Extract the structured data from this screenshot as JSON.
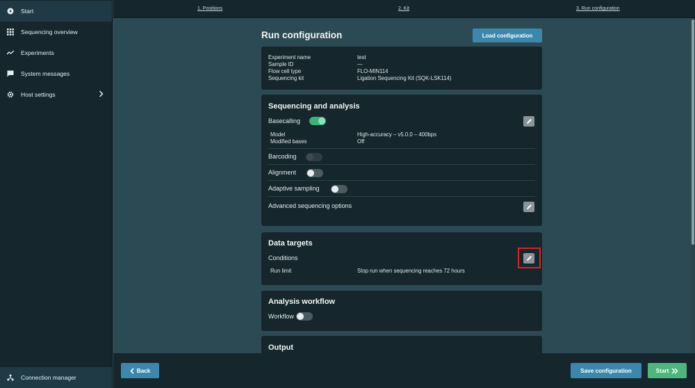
{
  "sidebar": {
    "items": [
      {
        "label": "Start",
        "icon": "play-circle-icon"
      },
      {
        "label": "Sequencing overview",
        "icon": "grid-icon"
      },
      {
        "label": "Experiments",
        "icon": "trend-line-icon"
      },
      {
        "label": "System messages",
        "icon": "chat-bubble-icon"
      },
      {
        "label": "Host settings",
        "icon": "gear-icon"
      }
    ],
    "bottom_label": "Connection manager",
    "bottom_icon": "network-icon"
  },
  "steps": [
    "1. Positions",
    "2. Kit",
    "3. Run configuration"
  ],
  "page": {
    "title": "Run configuration",
    "load_button": "Load configuration"
  },
  "summary": [
    {
      "key": "Experiment name",
      "value": "test"
    },
    {
      "key": "Sample ID",
      "value": "—"
    },
    {
      "key": "Flow cell type",
      "value": "FLO-MIN114"
    },
    {
      "key": "Sequencing kit",
      "value": "Ligation Sequencing Kit (SQK-LSK114)"
    }
  ],
  "sequencing": {
    "title": "Sequencing and analysis",
    "basecalling_label": "Basecalling",
    "model_key": "Model",
    "model_value": "High-accuracy – v5.0.0 – 400bps",
    "modified_key": "Modified bases",
    "modified_value": "Off",
    "barcoding_label": "Barcoding",
    "alignment_label": "Alignment",
    "adaptive_label": "Adaptive sampling",
    "advanced_label": "Advanced sequencing options"
  },
  "data_targets": {
    "title": "Data targets",
    "conditions_label": "Conditions",
    "run_limit_key": "Run limit",
    "run_limit_value": "Stop run when sequencing reaches 72 hours"
  },
  "analysis": {
    "title": "Analysis workflow",
    "workflow_label": "Workflow"
  },
  "output": {
    "title": "Output"
  },
  "footer": {
    "back": "Back",
    "save": "Save configuration",
    "start": "Start"
  },
  "colors": {
    "accent": "#3c88ad",
    "start_green": "#4bb77c",
    "highlight": "#e0201e"
  }
}
